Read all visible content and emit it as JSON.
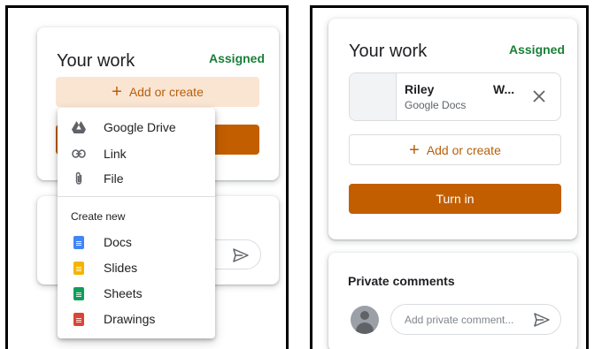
{
  "left": {
    "work": {
      "title": "Your work",
      "status": "Assigned",
      "add_label": "Add or create"
    },
    "menu": {
      "items": [
        {
          "label": "Google Drive",
          "icon": "google-drive-icon"
        },
        {
          "label": "Link",
          "icon": "link-icon"
        },
        {
          "label": "File",
          "icon": "attachment-icon"
        }
      ],
      "create_heading": "Create new",
      "create_items": [
        {
          "label": "Docs",
          "icon": "docs-icon",
          "color": "#4285f4"
        },
        {
          "label": "Slides",
          "icon": "slides-icon",
          "color": "#f4b400"
        },
        {
          "label": "Sheets",
          "icon": "sheets-icon",
          "color": "#0f9d58"
        },
        {
          "label": "Drawings",
          "icon": "drawings-icon",
          "color": "#db4437"
        }
      ]
    },
    "comment_placeholder": "..."
  },
  "right": {
    "work": {
      "title": "Your work",
      "status": "Assigned",
      "add_label": "Add or create",
      "turn_in_label": "Turn in"
    },
    "attachment": {
      "name": "Riley",
      "name_suffix": "W...",
      "type": "Google Docs"
    },
    "private_comments": {
      "title": "Private comments",
      "placeholder": "Add private comment..."
    }
  },
  "colors": {
    "accent": "#c25e00",
    "accent_text": "#b75f0a",
    "status_green": "#188038",
    "add_bg_active": "#fae5d3"
  }
}
